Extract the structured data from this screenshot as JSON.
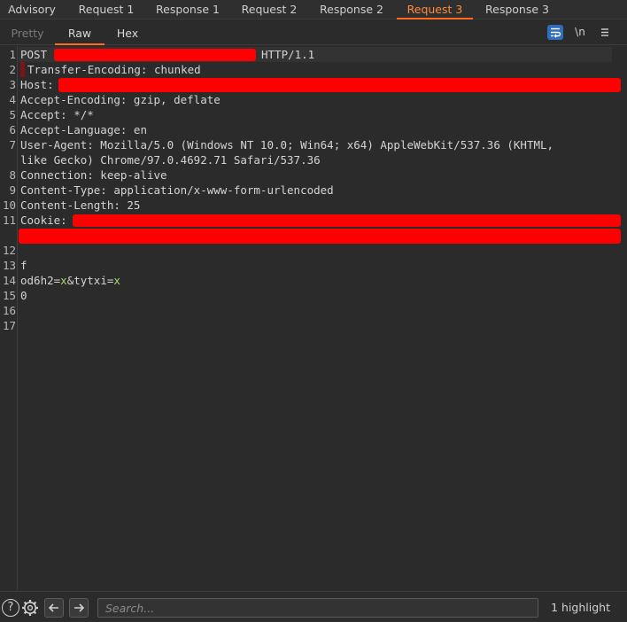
{
  "tabs": [
    "Advisory",
    "Request 1",
    "Response 1",
    "Request 2",
    "Response 2",
    "Request 3",
    "Response 3"
  ],
  "active_tab": "Request 3",
  "view_tabs": [
    "Pretty",
    "Raw",
    "Hex"
  ],
  "active_view_tab": "Raw",
  "toolbar": {
    "wrap_icon": "text-wrap-icon",
    "newline_label": "\\n",
    "menu_icon": "hamburger-menu-icon"
  },
  "editor": {
    "line_numbers": [
      "1",
      "2",
      "3",
      "4",
      "5",
      "6",
      "7",
      "",
      "8",
      "9",
      "10",
      "11",
      "",
      "12",
      "13",
      "14",
      "15",
      "16",
      "17"
    ],
    "lines": {
      "l1_method": "POST",
      "l1_version": "HTTP/1.1",
      "l2": "Transfer-Encoding: chunked",
      "l3": "Host:",
      "l4": "Accept-Encoding: gzip, deflate",
      "l5": "Accept: */*",
      "l6": "Accept-Language: en",
      "l7a": "User-Agent: Mozilla/5.0 (Windows NT 10.0; Win64; x64) AppleWebKit/537.36 (KHTML,",
      "l7b": "like Gecko) Chrome/97.0.4692.71 Safari/537.36",
      "l8": "Connection: keep-alive",
      "l9": "Content-Type: application/x-www-form-urlencoded",
      "l10": "Content-Length: 25",
      "l11": "Cookie:",
      "l13": "f",
      "l14_p1": "od6h2=",
      "l14_v1": "x",
      "l14_p2": "&tytxi=",
      "l14_v2": "x",
      "l15": "0"
    },
    "redaction_color": "#ff0000"
  },
  "bottom": {
    "help_icon": "help-icon",
    "settings_icon": "gear-icon",
    "back_icon": "arrow-left-icon",
    "forward_icon": "arrow-right-icon",
    "search_placeholder": "Search...",
    "search_value": "",
    "highlight_count": "1 highlight"
  },
  "colors": {
    "accent": "#ff6b1a",
    "active_tab_text": "#ff8a3d",
    "wrap_active_bg": "#2f6dbd"
  }
}
